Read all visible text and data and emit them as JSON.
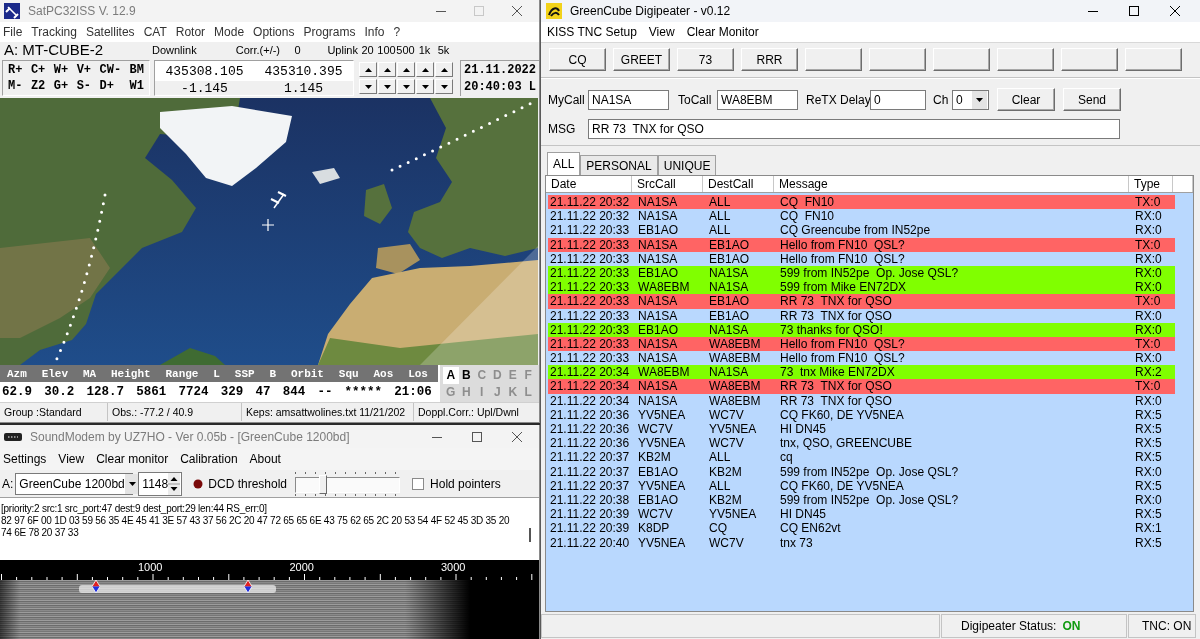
{
  "satpc32": {
    "title": "SatPC32ISS V. 12.9",
    "active": false,
    "maximize_disabled": true,
    "menu": [
      "File",
      "Tracking",
      "Satellites",
      "CAT",
      "Rotor",
      "Mode",
      "Options",
      "Programs",
      "Info",
      "?"
    ],
    "satellite": "A: MT-CUBE-2",
    "downlink_label": "Downlink",
    "corr_label": "Corr.(+/-)",
    "corr_value": "0",
    "uplink_label": "Uplink",
    "steps": [
      "20",
      "100",
      "500",
      "1k",
      "5k"
    ],
    "key_rows": [
      [
        "R+",
        "C+",
        "W+",
        "V+",
        "CW-",
        "BM"
      ],
      [
        "M-",
        "Z2",
        "G+",
        "S-",
        "D+",
        "W1"
      ]
    ],
    "frequencies": [
      "435308.105",
      "435310.395"
    ],
    "doppler_shifts": [
      "-1.145",
      "1.145"
    ],
    "date": "21.11.2022",
    "time": "20:40:03 L",
    "data_table": {
      "columns": [
        "Azm",
        "Elev",
        "MA",
        "Height",
        "Range",
        "L",
        "SSP",
        "B",
        "Orbit",
        "Squ",
        "Aos",
        "Los"
      ],
      "values": [
        "62.9",
        "30.2",
        "128.7",
        "5861",
        "7724",
        "329",
        "47",
        "844",
        "--",
        "*****",
        "21:06"
      ]
    },
    "satellite_slots": [
      {
        "label": "A",
        "selected": true,
        "disabled": false
      },
      {
        "label": "B",
        "selected": false,
        "disabled": false
      },
      {
        "label": "C",
        "selected": false,
        "disabled": true
      },
      {
        "label": "D",
        "selected": false,
        "disabled": true
      },
      {
        "label": "E",
        "selected": false,
        "disabled": true
      },
      {
        "label": "F",
        "selected": false,
        "disabled": true
      },
      {
        "label": "G",
        "selected": false,
        "disabled": true
      },
      {
        "label": "H",
        "selected": false,
        "disabled": true
      },
      {
        "label": "I",
        "selected": false,
        "disabled": true
      },
      {
        "label": "J",
        "selected": false,
        "disabled": true
      },
      {
        "label": "K",
        "selected": false,
        "disabled": true
      },
      {
        "label": "L",
        "selected": false,
        "disabled": true
      }
    ],
    "status_bar": [
      "Group :Standard",
      "Obs.: -77.2 / 40.9",
      "Keps: amsattwolines.txt 11/21/202",
      "Doppl.Corr.: Upl/Dwnl"
    ]
  },
  "soundmodem": {
    "title": "SoundModem by UZ7HO - Ver 0.05b - [GreenCube 1200bd]",
    "active": false,
    "menu": [
      "Settings",
      "View",
      "Clear monitor",
      "Calibration",
      "About"
    ],
    "channel_label": "A:",
    "modem": "GreenCube 1200bd",
    "frequency": "1148",
    "dcd_label": "DCD threshold",
    "dcd_threshold": {
      "level": 0.25
    },
    "hold_pointers": {
      "label": "Hold pointers",
      "checked": false
    },
    "monitor": [
      "[priority:2 src:1 src_port:47 dest:9 dest_port:29 len:44 RS_err:0]",
      "82 97 6F 00 1D 03 59 56 35 4E 45 41 3E 57 43 37 56 2C 20 47 72 65 65 6E 43 75 62 65 2C 20 53 54 4F 52 45 3D 35 20",
      "74 6E 78 20 37 33"
    ],
    "spectrum_scale": [
      "1000",
      "2000",
      "3000"
    ]
  },
  "greencube": {
    "title": "GreenCube Digipeater - v0.12",
    "active": true,
    "menu": [
      "KISS TNC Setup",
      "View",
      "Clear Monitor"
    ],
    "macro_buttons": [
      {
        "kind": "labeled",
        "label": "CQ"
      },
      {
        "kind": "labeled",
        "label": "GREET"
      },
      {
        "kind": "labeled",
        "label": "73"
      },
      {
        "kind": "labeled",
        "label": "RRR"
      },
      {
        "kind": "blank"
      },
      {
        "kind": "blank"
      },
      {
        "kind": "blank"
      },
      {
        "kind": "blank"
      },
      {
        "kind": "blank"
      },
      {
        "kind": "blank"
      }
    ],
    "mycall": {
      "label": "MyCall",
      "value": "NA1SA"
    },
    "tocall": {
      "label": "ToCall",
      "value": "WA8EBM"
    },
    "retx_delay": {
      "label": "ReTX Delay",
      "value": "0"
    },
    "channel": {
      "label": "Ch",
      "value": "0"
    },
    "actions": [
      "Clear",
      "Send"
    ],
    "message": {
      "label": "MSG",
      "value": "RR 73  TNX for QSO"
    },
    "tabs": [
      {
        "label": "ALL",
        "selected": true
      },
      {
        "label": "PERSONAL",
        "selected": false
      },
      {
        "label": "UNIQUE",
        "selected": false
      }
    ],
    "log": {
      "columns": [
        "Date",
        "SrcCall",
        "DestCall",
        "Message",
        "Type"
      ],
      "rows": [
        {
          "color": "#ff6464",
          "cells": [
            "21.11.22 20:32",
            "NA1SA",
            "ALL",
            "CQ  FN10",
            "TX:0"
          ]
        },
        {
          "color": "#b9d8fe",
          "cells": [
            "21.11.22 20:32",
            "NA1SA",
            "ALL",
            "CQ  FN10",
            "RX:0"
          ]
        },
        {
          "color": "#b9d8fe",
          "cells": [
            "21.11.22 20:33",
            "EB1AO",
            "ALL",
            "CQ Greencube from IN52pe",
            "RX:0"
          ]
        },
        {
          "color": "#ff6464",
          "cells": [
            "21.11.22 20:33",
            "NA1SA",
            "EB1AO",
            "Hello from FN10  QSL?",
            "TX:0"
          ]
        },
        {
          "color": "#b9d8fe",
          "cells": [
            "21.11.22 20:33",
            "NA1SA",
            "EB1AO",
            "Hello from FN10  QSL?",
            "RX:0"
          ]
        },
        {
          "color": "#80ff00",
          "cells": [
            "21.11.22 20:33",
            "EB1AO",
            "NA1SA",
            "599 from IN52pe  Op. Jose QSL?",
            "RX:0"
          ]
        },
        {
          "color": "#80ff00",
          "cells": [
            "21.11.22 20:33",
            "WA8EBM",
            "NA1SA",
            "599 from Mike EN72DX",
            "RX:0"
          ]
        },
        {
          "color": "#ff6464",
          "cells": [
            "21.11.22 20:33",
            "NA1SA",
            "EB1AO",
            "RR 73  TNX for QSO",
            "TX:0"
          ]
        },
        {
          "color": "#b9d8fe",
          "cells": [
            "21.11.22 20:33",
            "NA1SA",
            "EB1AO",
            "RR 73  TNX for QSO",
            "RX:0"
          ]
        },
        {
          "color": "#80ff00",
          "cells": [
            "21.11.22 20:33",
            "EB1AO",
            "NA1SA",
            "73 thanks for QSO!",
            "RX:0"
          ]
        },
        {
          "color": "#ff6464",
          "cells": [
            "21.11.22 20:33",
            "NA1SA",
            "WA8EBM",
            "Hello from FN10  QSL?",
            "TX:0"
          ]
        },
        {
          "color": "#b9d8fe",
          "cells": [
            "21.11.22 20:33",
            "NA1SA",
            "WA8EBM",
            "Hello from FN10  QSL?",
            "RX:0"
          ]
        },
        {
          "color": "#80ff00",
          "cells": [
            "21.11.22 20:34",
            "WA8EBM",
            "NA1SA",
            "73  tnx Mike EN72DX",
            "RX:2"
          ]
        },
        {
          "color": "#ff6464",
          "cells": [
            "21.11.22 20:34",
            "NA1SA",
            "WA8EBM",
            "RR 73  TNX for QSO",
            "TX:0"
          ]
        },
        {
          "color": "#b9d8fe",
          "cells": [
            "21.11.22 20:34",
            "NA1SA",
            "WA8EBM",
            "RR 73  TNX for QSO",
            "RX:0"
          ]
        },
        {
          "color": "#b9d8fe",
          "cells": [
            "21.11.22 20:36",
            "YV5NEA",
            "WC7V",
            "CQ FK60, DE YV5NEA",
            "RX:5"
          ]
        },
        {
          "color": "#b9d8fe",
          "cells": [
            "21.11.22 20:36",
            "WC7V",
            "YV5NEA",
            "HI DN45",
            "RX:5"
          ]
        },
        {
          "color": "#b9d8fe",
          "cells": [
            "21.11.22 20:36",
            "YV5NEA",
            "WC7V",
            "tnx, QSO, GREENCUBE",
            "RX:5"
          ]
        },
        {
          "color": "#b9d8fe",
          "cells": [
            "21.11.22 20:37",
            "KB2M",
            "ALL",
            "cq",
            "RX:5"
          ]
        },
        {
          "color": "#b9d8fe",
          "cells": [
            "21.11.22 20:37",
            "EB1AO",
            "KB2M",
            "599 from IN52pe  Op. Jose QSL?",
            "RX:0"
          ]
        },
        {
          "color": "#b9d8fe",
          "cells": [
            "21.11.22 20:37",
            "YV5NEA",
            "ALL",
            "CQ FK60, DE YV5NEA",
            "RX:5"
          ]
        },
        {
          "color": "#b9d8fe",
          "cells": [
            "21.11.22 20:38",
            "EB1AO",
            "KB2M",
            "599 from IN52pe  Op. Jose QSL?",
            "RX:0"
          ]
        },
        {
          "color": "#b9d8fe",
          "cells": [
            "21.11.22 20:39",
            "WC7V",
            "YV5NEA",
            "HI DN45",
            "RX:5"
          ]
        },
        {
          "color": "#b9d8fe",
          "cells": [
            "21.11.22 20:39",
            "K8DP",
            "CQ",
            "CQ EN62vt",
            "RX:1"
          ]
        },
        {
          "color": "#b9d8fe",
          "cells": [
            "21.11.22 20:40",
            "YV5NEA",
            "WC7V",
            "tnx 73",
            "RX:5"
          ]
        }
      ]
    },
    "status": {
      "label": "Digipeater Status:",
      "value": "ON",
      "tnc": "TNC: ON"
    }
  }
}
